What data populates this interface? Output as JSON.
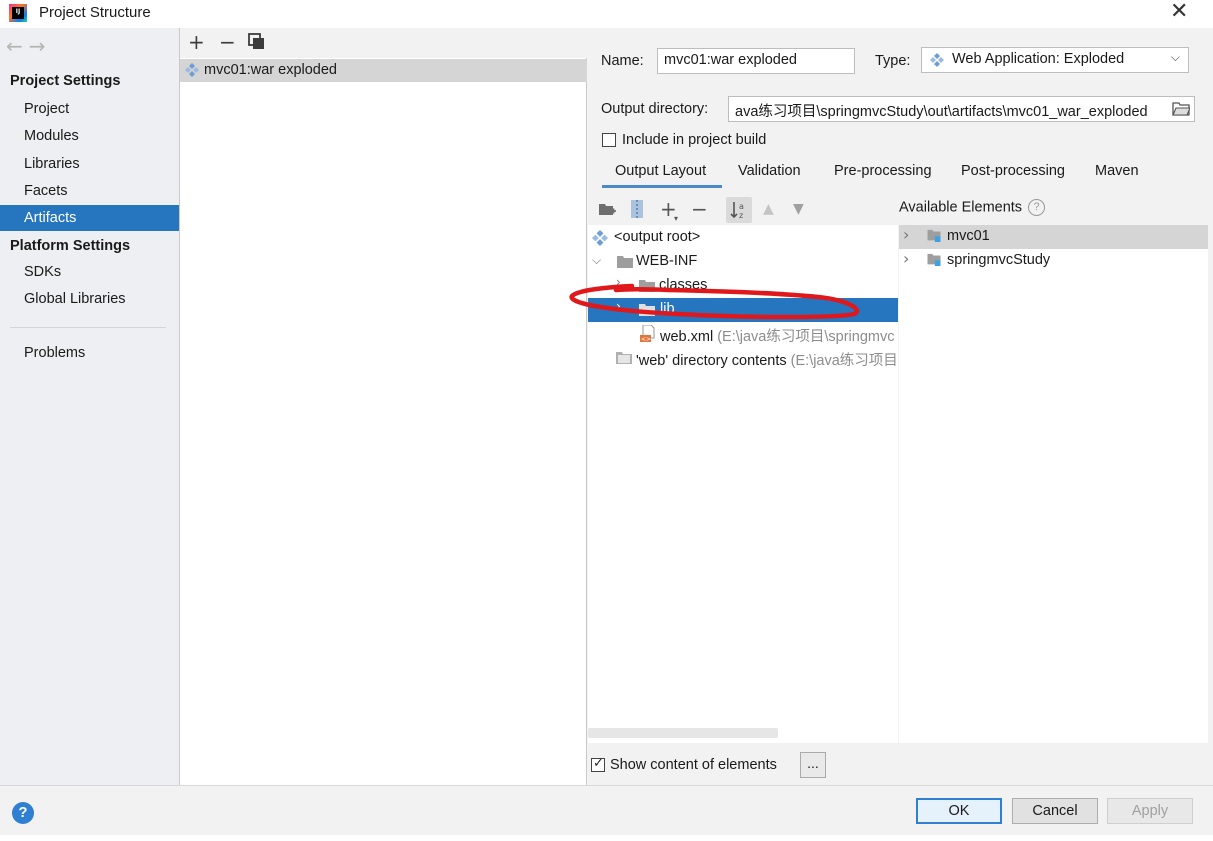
{
  "window": {
    "title": "Project Structure",
    "icon": "intellij-idea-icon",
    "close_glyph": "✕"
  },
  "nav": {
    "back_icon": "arrow-left-icon",
    "forward_icon": "arrow-right-icon",
    "project_settings_header": "Project Settings",
    "project_settings_items": [
      "Project",
      "Modules",
      "Libraries",
      "Facets",
      "Artifacts"
    ],
    "selected_item": "Artifacts",
    "platform_settings_header": "Platform Settings",
    "platform_settings_items": [
      "SDKs",
      "Global Libraries"
    ],
    "problems": "Problems"
  },
  "artifacts": {
    "add_glyph": "+",
    "remove_glyph": "−",
    "items": [
      "mvc01:war exploded"
    ]
  },
  "details": {
    "name_label": "Name:",
    "name_value": "mvc01:war exploded",
    "type_label": "Type:",
    "type_value": "Web Application: Exploded",
    "output_dir_label": "Output directory:",
    "output_dir_value": "ava练习项目\\springmvcStudy\\out\\artifacts\\mvc01_war_exploded",
    "include_build_label": "Include in project build",
    "include_build_checked": false,
    "tabs": [
      "Output Layout",
      "Validation",
      "Pre-processing",
      "Post-processing",
      "Maven"
    ],
    "active_tab": "Output Layout"
  },
  "layout_tree": {
    "add_glyph": "+",
    "remove_glyph": "−",
    "rows": [
      {
        "label": "<output root>",
        "extra": ""
      },
      {
        "label": "WEB-INF",
        "extra": ""
      },
      {
        "label": "classes",
        "extra": ""
      },
      {
        "label": "lib",
        "extra": ""
      },
      {
        "label": "web.xml",
        "extra": "(E:\\java练习项目\\springmvc"
      },
      {
        "label": "'web' directory contents",
        "extra": "(E:\\java练习项目"
      }
    ],
    "selected": "lib"
  },
  "available": {
    "header": "Available Elements",
    "help_glyph": "?",
    "items": [
      "mvc01",
      "springmvcStudy"
    ]
  },
  "bottom": {
    "show_content_label": "Show content of elements",
    "show_content_checked": true,
    "dots_label": "..."
  },
  "footer": {
    "help_glyph": "?",
    "ok": "OK",
    "cancel": "Cancel",
    "apply": "Apply"
  },
  "colors": {
    "selection": "#2675bf",
    "annotation": "#e0181b",
    "primary_border": "#2f7fd2"
  }
}
